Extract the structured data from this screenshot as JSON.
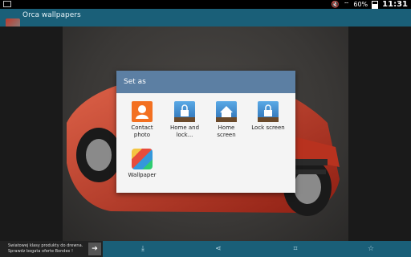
{
  "status": {
    "battery": "60%",
    "time": "11:31"
  },
  "app": {
    "title": "Orca wallpapers"
  },
  "dialog": {
    "title": "Set as",
    "options": [
      {
        "label_line1": "Contact",
        "label_line2": "photo"
      },
      {
        "label_line1": "Home and",
        "label_line2": "lock..."
      },
      {
        "label_line1": "Home",
        "label_line2": "screen"
      },
      {
        "label_line1": "Lock screen",
        "label_line2": ""
      },
      {
        "label_line1": "Wallpaper",
        "label_line2": ""
      }
    ]
  },
  "ad": {
    "line1": "Swiatowej klasy produkty do drewna.",
    "line2": "Sprawdz bogata oferte Bondex !"
  },
  "colors": {
    "appbar": "#1a5f78",
    "dialog_header": "#5c7fa3",
    "contact_orange": "#f37021"
  }
}
